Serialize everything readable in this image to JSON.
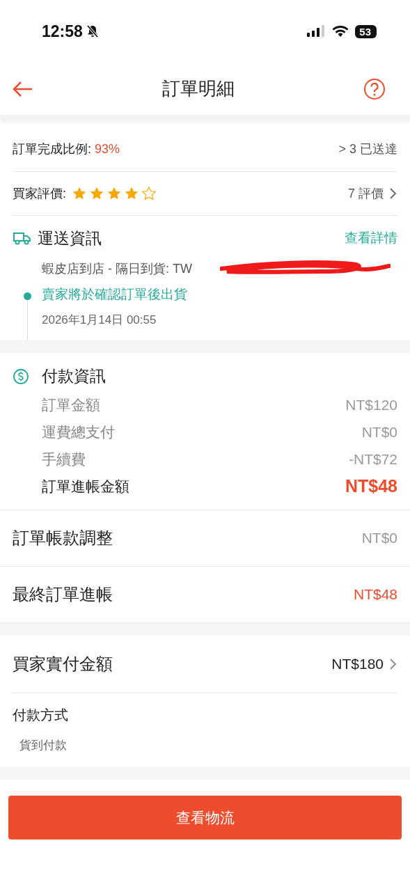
{
  "status_bar": {
    "time": "12:58",
    "battery": "53"
  },
  "header": {
    "title": "訂單明細"
  },
  "seller_stats": {
    "completion_label": "訂單完成比例: ",
    "completion_value": "93%",
    "delivered": "> 3 已送達",
    "rating_label": "買家評價: ",
    "stars": 4,
    "reviews": "7 評價"
  },
  "shipping": {
    "title": "運送資訊",
    "link": "查看詳情",
    "method": "蝦皮店到店 - 隔日到貨: TW",
    "redacted": true,
    "event": "賣家將於確認訂單後出貨",
    "event_time": "2026年1月14日 00:55"
  },
  "payment": {
    "title": "付款資訊",
    "rows": [
      {
        "label": "訂單金額",
        "value": "NT$120",
        "kind": "normal"
      },
      {
        "label": "運費總支付",
        "value": "NT$0",
        "kind": "normal"
      },
      {
        "label": "手續費",
        "value": "-NT$72",
        "kind": "normal"
      },
      {
        "label": "訂單進帳金額",
        "value": "NT$48",
        "kind": "total"
      }
    ]
  },
  "summary": [
    {
      "label": "訂單帳款調整",
      "value": "NT$0",
      "highlight": false
    },
    {
      "label": "最終訂單進帳",
      "value": "NT$48",
      "highlight": true
    }
  ],
  "buyer_paid": {
    "label": "買家實付金額",
    "value": "NT$180"
  },
  "payment_method": {
    "label": "付款方式",
    "value": "貨到付款"
  },
  "action_button": "查看物流"
}
